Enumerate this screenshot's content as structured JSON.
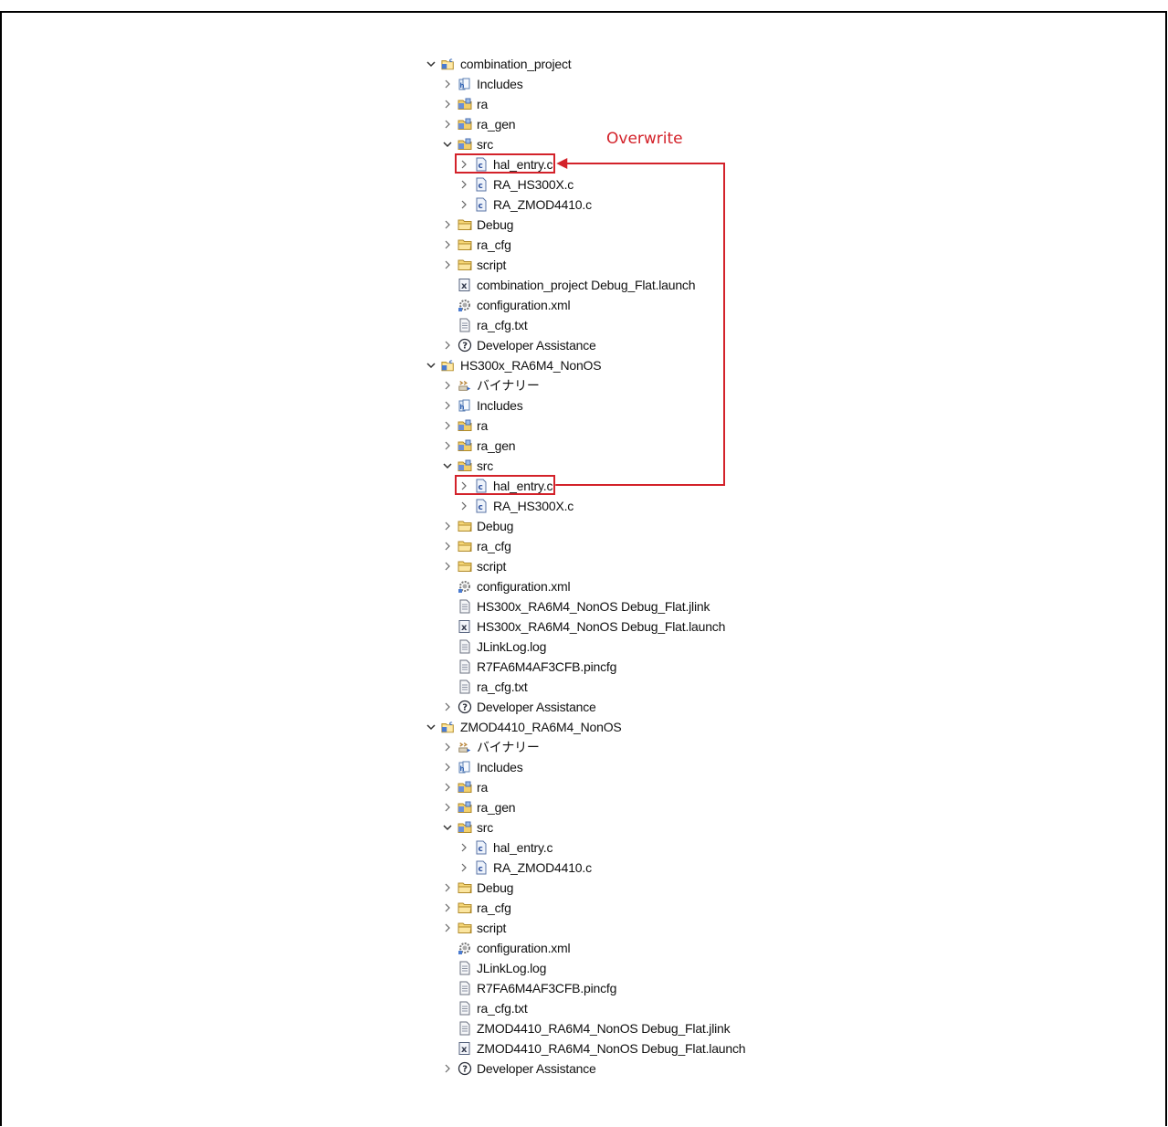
{
  "annotation": {
    "label": "Overwrite",
    "color": "#d3222a"
  },
  "tree": [
    {
      "depth": 0,
      "twisty": "expanded",
      "icon": "c-project-icon",
      "label": "combination_project"
    },
    {
      "depth": 1,
      "twisty": "collapsed",
      "icon": "includes-icon",
      "label": "Includes"
    },
    {
      "depth": 1,
      "twisty": "collapsed",
      "icon": "source-folder-icon",
      "label": "ra"
    },
    {
      "depth": 1,
      "twisty": "collapsed",
      "icon": "source-folder-icon",
      "label": "ra_gen"
    },
    {
      "depth": 1,
      "twisty": "expanded",
      "icon": "source-folder-icon",
      "label": "src"
    },
    {
      "depth": 2,
      "twisty": "collapsed",
      "icon": "c-file-icon",
      "label": "hal_entry.c",
      "highlight": true
    },
    {
      "depth": 2,
      "twisty": "collapsed",
      "icon": "c-file-icon",
      "label": "RA_HS300X.c"
    },
    {
      "depth": 2,
      "twisty": "collapsed",
      "icon": "c-file-icon",
      "label": "RA_ZMOD4410.c"
    },
    {
      "depth": 1,
      "twisty": "collapsed",
      "icon": "folder-icon",
      "label": "Debug"
    },
    {
      "depth": 1,
      "twisty": "collapsed",
      "icon": "folder-icon",
      "label": "ra_cfg"
    },
    {
      "depth": 1,
      "twisty": "collapsed",
      "icon": "folder-icon",
      "label": "script"
    },
    {
      "depth": 1,
      "twisty": "none",
      "icon": "launch-file-icon",
      "label": "combination_project Debug_Flat.launch"
    },
    {
      "depth": 1,
      "twisty": "none",
      "icon": "config-gear-icon",
      "label": "configuration.xml"
    },
    {
      "depth": 1,
      "twisty": "none",
      "icon": "text-file-icon",
      "label": "ra_cfg.txt"
    },
    {
      "depth": 1,
      "twisty": "collapsed",
      "icon": "help-icon",
      "label": "Developer Assistance"
    },
    {
      "depth": 0,
      "twisty": "expanded",
      "icon": "c-project-icon",
      "label": "HS300x_RA6M4_NonOS"
    },
    {
      "depth": 1,
      "twisty": "collapsed",
      "icon": "binaries-icon",
      "label": "バイナリー"
    },
    {
      "depth": 1,
      "twisty": "collapsed",
      "icon": "includes-icon",
      "label": "Includes"
    },
    {
      "depth": 1,
      "twisty": "collapsed",
      "icon": "source-folder-icon",
      "label": "ra"
    },
    {
      "depth": 1,
      "twisty": "collapsed",
      "icon": "source-folder-icon",
      "label": "ra_gen"
    },
    {
      "depth": 1,
      "twisty": "expanded",
      "icon": "source-folder-icon",
      "label": "src"
    },
    {
      "depth": 2,
      "twisty": "collapsed",
      "icon": "c-file-icon",
      "label": "hal_entry.c",
      "highlight": true
    },
    {
      "depth": 2,
      "twisty": "collapsed",
      "icon": "c-file-icon",
      "label": "RA_HS300X.c"
    },
    {
      "depth": 1,
      "twisty": "collapsed",
      "icon": "folder-icon",
      "label": "Debug"
    },
    {
      "depth": 1,
      "twisty": "collapsed",
      "icon": "folder-icon",
      "label": "ra_cfg"
    },
    {
      "depth": 1,
      "twisty": "collapsed",
      "icon": "folder-icon",
      "label": "script"
    },
    {
      "depth": 1,
      "twisty": "none",
      "icon": "config-gear-icon",
      "label": "configuration.xml"
    },
    {
      "depth": 1,
      "twisty": "none",
      "icon": "text-file-icon",
      "label": "HS300x_RA6M4_NonOS Debug_Flat.jlink"
    },
    {
      "depth": 1,
      "twisty": "none",
      "icon": "launch-file-icon",
      "label": "HS300x_RA6M4_NonOS Debug_Flat.launch"
    },
    {
      "depth": 1,
      "twisty": "none",
      "icon": "text-file-icon",
      "label": "JLinkLog.log"
    },
    {
      "depth": 1,
      "twisty": "none",
      "icon": "text-file-icon",
      "label": "R7FA6M4AF3CFB.pincfg"
    },
    {
      "depth": 1,
      "twisty": "none",
      "icon": "text-file-icon",
      "label": "ra_cfg.txt"
    },
    {
      "depth": 1,
      "twisty": "collapsed",
      "icon": "help-icon",
      "label": "Developer Assistance"
    },
    {
      "depth": 0,
      "twisty": "expanded",
      "icon": "c-project-icon",
      "label": "ZMOD4410_RA6M4_NonOS"
    },
    {
      "depth": 1,
      "twisty": "collapsed",
      "icon": "binaries-icon",
      "label": "バイナリー"
    },
    {
      "depth": 1,
      "twisty": "collapsed",
      "icon": "includes-icon",
      "label": "Includes"
    },
    {
      "depth": 1,
      "twisty": "collapsed",
      "icon": "source-folder-icon",
      "label": "ra"
    },
    {
      "depth": 1,
      "twisty": "collapsed",
      "icon": "source-folder-icon",
      "label": "ra_gen"
    },
    {
      "depth": 1,
      "twisty": "expanded",
      "icon": "source-folder-icon",
      "label": "src"
    },
    {
      "depth": 2,
      "twisty": "collapsed",
      "icon": "c-file-icon",
      "label": "hal_entry.c"
    },
    {
      "depth": 2,
      "twisty": "collapsed",
      "icon": "c-file-icon",
      "label": "RA_ZMOD4410.c"
    },
    {
      "depth": 1,
      "twisty": "collapsed",
      "icon": "folder-icon",
      "label": "Debug"
    },
    {
      "depth": 1,
      "twisty": "collapsed",
      "icon": "folder-icon",
      "label": "ra_cfg"
    },
    {
      "depth": 1,
      "twisty": "collapsed",
      "icon": "folder-icon",
      "label": "script"
    },
    {
      "depth": 1,
      "twisty": "none",
      "icon": "config-gear-icon",
      "label": "configuration.xml"
    },
    {
      "depth": 1,
      "twisty": "none",
      "icon": "text-file-icon",
      "label": "JLinkLog.log"
    },
    {
      "depth": 1,
      "twisty": "none",
      "icon": "text-file-icon",
      "label": "R7FA6M4AF3CFB.pincfg"
    },
    {
      "depth": 1,
      "twisty": "none",
      "icon": "text-file-icon",
      "label": "ra_cfg.txt"
    },
    {
      "depth": 1,
      "twisty": "none",
      "icon": "text-file-icon",
      "label": "ZMOD4410_RA6M4_NonOS Debug_Flat.jlink"
    },
    {
      "depth": 1,
      "twisty": "none",
      "icon": "launch-file-icon",
      "label": "ZMOD4410_RA6M4_NonOS Debug_Flat.launch"
    },
    {
      "depth": 1,
      "twisty": "collapsed",
      "icon": "help-icon",
      "label": "Developer Assistance"
    }
  ]
}
